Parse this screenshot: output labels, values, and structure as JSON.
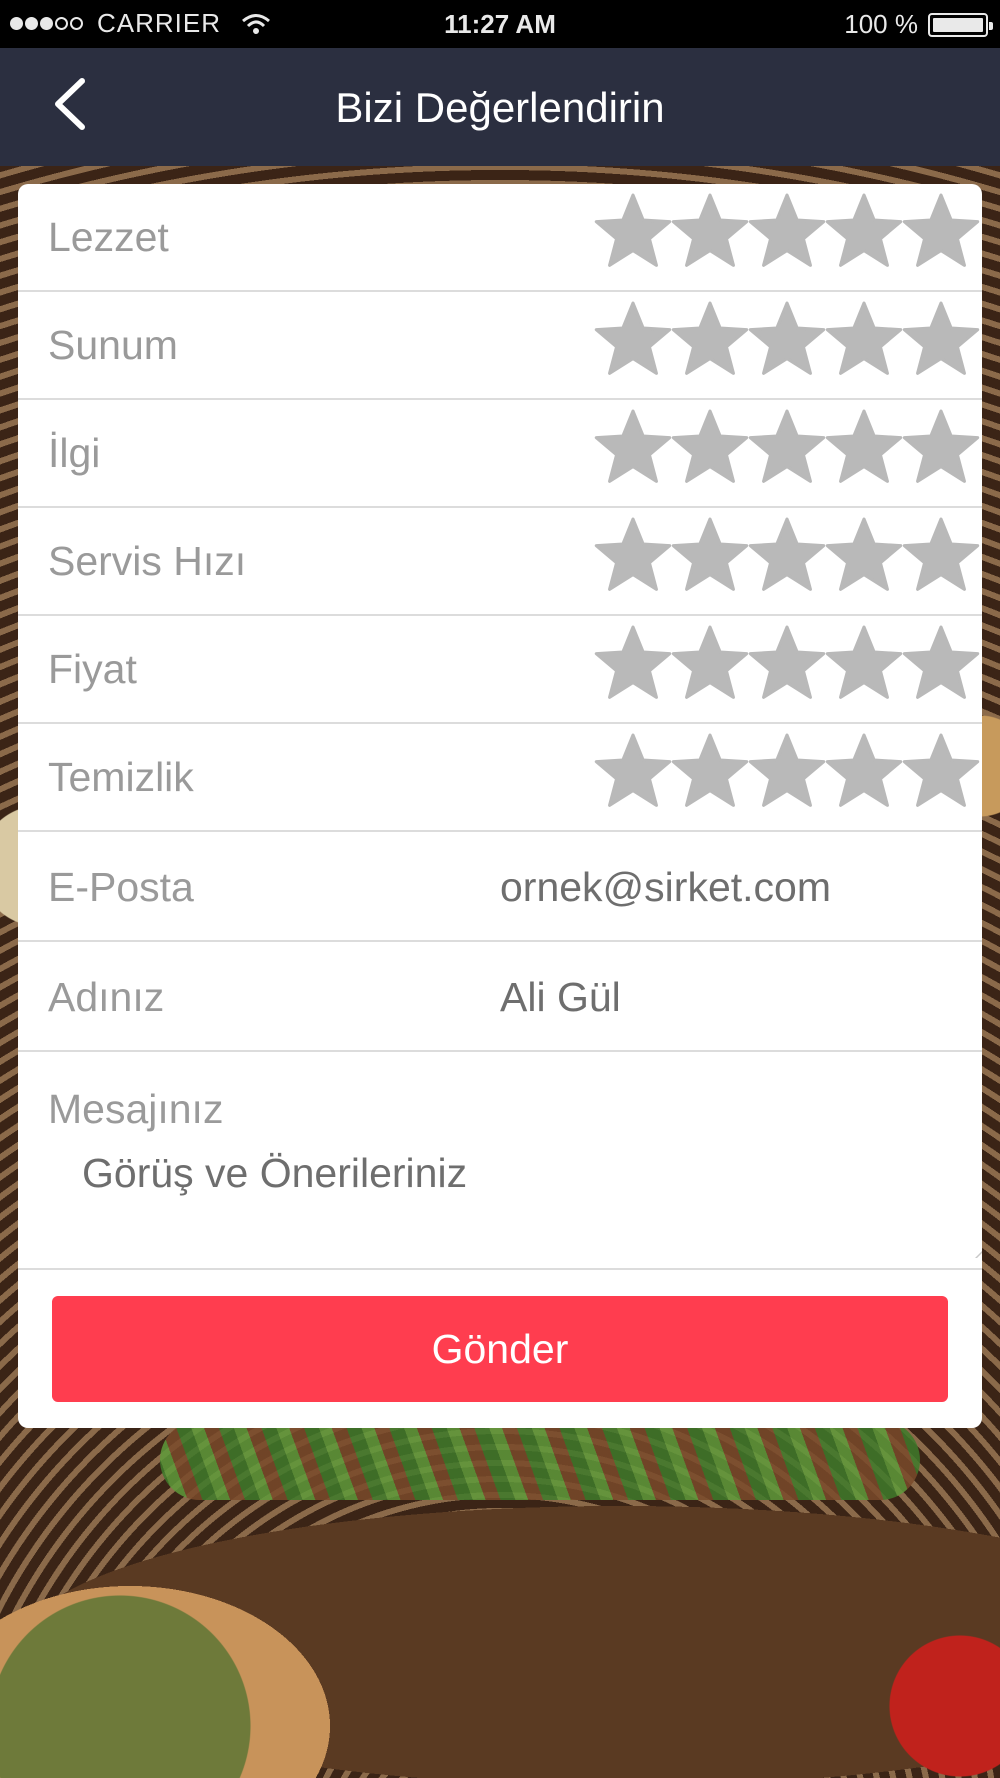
{
  "status_bar": {
    "carrier": "CARRIER",
    "signal_bars_filled": 3,
    "signal_bars_total": 5,
    "time": "11:27 AM",
    "battery": "100 %"
  },
  "nav": {
    "title": "Bizi Değerlendirin",
    "back_icon": "chevron-left-icon"
  },
  "ratings": [
    {
      "label": "Lezzet",
      "stars_total": 5,
      "stars_selected": 0
    },
    {
      "label": "Sunum",
      "stars_total": 5,
      "stars_selected": 0
    },
    {
      "label": "İlgi",
      "stars_total": 5,
      "stars_selected": 0
    },
    {
      "label": "Servis Hızı",
      "stars_total": 5,
      "stars_selected": 0
    },
    {
      "label": "Fiyat",
      "stars_total": 5,
      "stars_selected": 0
    },
    {
      "label": "Temizlik",
      "stars_total": 5,
      "stars_selected": 0
    }
  ],
  "fields": {
    "email": {
      "label": "E-Posta",
      "placeholder": "ornek@sirket.com"
    },
    "name": {
      "label": "Adınız",
      "placeholder": "Ali Gül"
    },
    "message": {
      "label": "Mesajınız",
      "placeholder": "Görüş ve Önerileriniz"
    }
  },
  "submit_label": "Gönder",
  "colors": {
    "navbar": "#2b2f40",
    "submit": "#ff3d4f",
    "star_empty": "#b9b9b9",
    "label": "#9a9a9a"
  }
}
